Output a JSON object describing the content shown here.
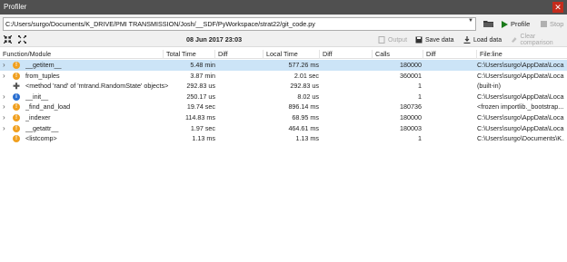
{
  "window": {
    "title": "Profiler"
  },
  "pathbar": {
    "path": "C:/Users/surgo/Documents/K_DRIVE/PMI TRANSMISSION/Josh/__SDF/PyWorkspace/strat22/git_code.py",
    "profile_label": "Profile",
    "stop_label": "Stop"
  },
  "toolbar": {
    "datetime": "08 Jun 2017 23:03",
    "output_label": "Output",
    "save_label": "Save data",
    "load_label": "Load data",
    "clear_label": "Clear comparison"
  },
  "columns": {
    "function": "Function/Module",
    "total_time": "Total Time",
    "diff1": "Diff",
    "local_time": "Local Time",
    "diff2": "Diff",
    "calls": "Calls",
    "diff3": "Diff",
    "file": "File:line"
  },
  "rows": [
    {
      "expander": "›",
      "icon": "warn",
      "name": "__getitem__",
      "total": "5.48 min",
      "local": "577.26 ms",
      "calls": "180000",
      "file": "C:\\Users\\surgo\\AppData\\Loca...",
      "selected": true
    },
    {
      "expander": "›",
      "icon": "warn",
      "name": "from_tuples",
      "total": "3.87 min",
      "local": "2.01 sec",
      "calls": "360001",
      "file": "C:\\Users\\surgo\\AppData\\Loca...",
      "selected": false
    },
    {
      "expander": "",
      "icon": "plus",
      "name": "<method 'rand' of 'mtrand.RandomState' objects>",
      "total": "292.83 us",
      "local": "292.83 us",
      "calls": "1",
      "file": "(built-in)",
      "selected": false
    },
    {
      "expander": "›",
      "icon": "info",
      "name": "__init__",
      "total": "250.17 us",
      "local": "8.02 us",
      "calls": "1",
      "file": "C:\\Users\\surgo\\AppData\\Loca...",
      "selected": false
    },
    {
      "expander": "›",
      "icon": "warn",
      "name": "_find_and_load",
      "total": "19.74 sec",
      "local": "896.14 ms",
      "calls": "180736",
      "file": "<frozen importlib._bootstrap...",
      "selected": false
    },
    {
      "expander": "›",
      "icon": "warn",
      "name": "_indexer",
      "total": "114.83 ms",
      "local": "68.95 ms",
      "calls": "180000",
      "file": "C:\\Users\\surgo\\AppData\\Loca...",
      "selected": false
    },
    {
      "expander": "›",
      "icon": "warn",
      "name": "__getattr__",
      "total": "1.97 sec",
      "local": "464.61 ms",
      "calls": "180003",
      "file": "C:\\Users\\surgo\\AppData\\Loca...",
      "selected": false
    },
    {
      "expander": "",
      "icon": "warn",
      "name": "<listcomp>",
      "total": "1.13 ms",
      "local": "1.13 ms",
      "calls": "1",
      "file": "C:\\Users\\surgo\\Documents\\K...",
      "selected": false
    }
  ],
  "colors": {
    "selection": "#cce4f7",
    "warn": "#f0a020",
    "info": "#2a6fd1",
    "play": "#1a7a1a",
    "close": "#c42b1c"
  }
}
